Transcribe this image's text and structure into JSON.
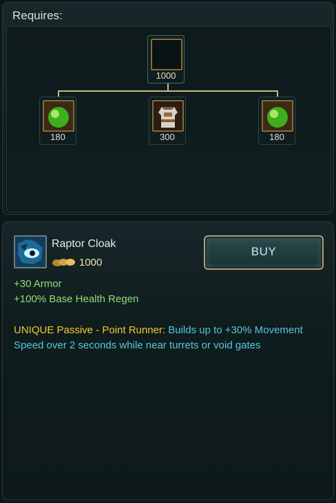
{
  "requires": {
    "title": "Requires:",
    "parent": {
      "price": "1000",
      "icon": "empty-item-slot-icon"
    },
    "components": [
      {
        "price": "180",
        "icon": "green-orb-icon"
      },
      {
        "price": "300",
        "icon": "cloth-armor-icon"
      },
      {
        "price": "180",
        "icon": "green-orb-icon"
      }
    ]
  },
  "item": {
    "name": "Raptor Cloak",
    "icon": "raptor-cloak-icon",
    "cost": "1000",
    "buy_label": "BUY",
    "stats": [
      "+30 Armor",
      "+100% Base Health Regen"
    ],
    "passive_title": "UNIQUE Passive - Point Runner:",
    "passive_text": " Builds up to +30% Movement Speed over 2 seconds while near turrets or void gates"
  },
  "colors": {
    "stat_green": "#8fe075",
    "unique_gold": "#f4c92f",
    "description_cyan": "#58c8d8",
    "connector": "#c9b98a"
  }
}
